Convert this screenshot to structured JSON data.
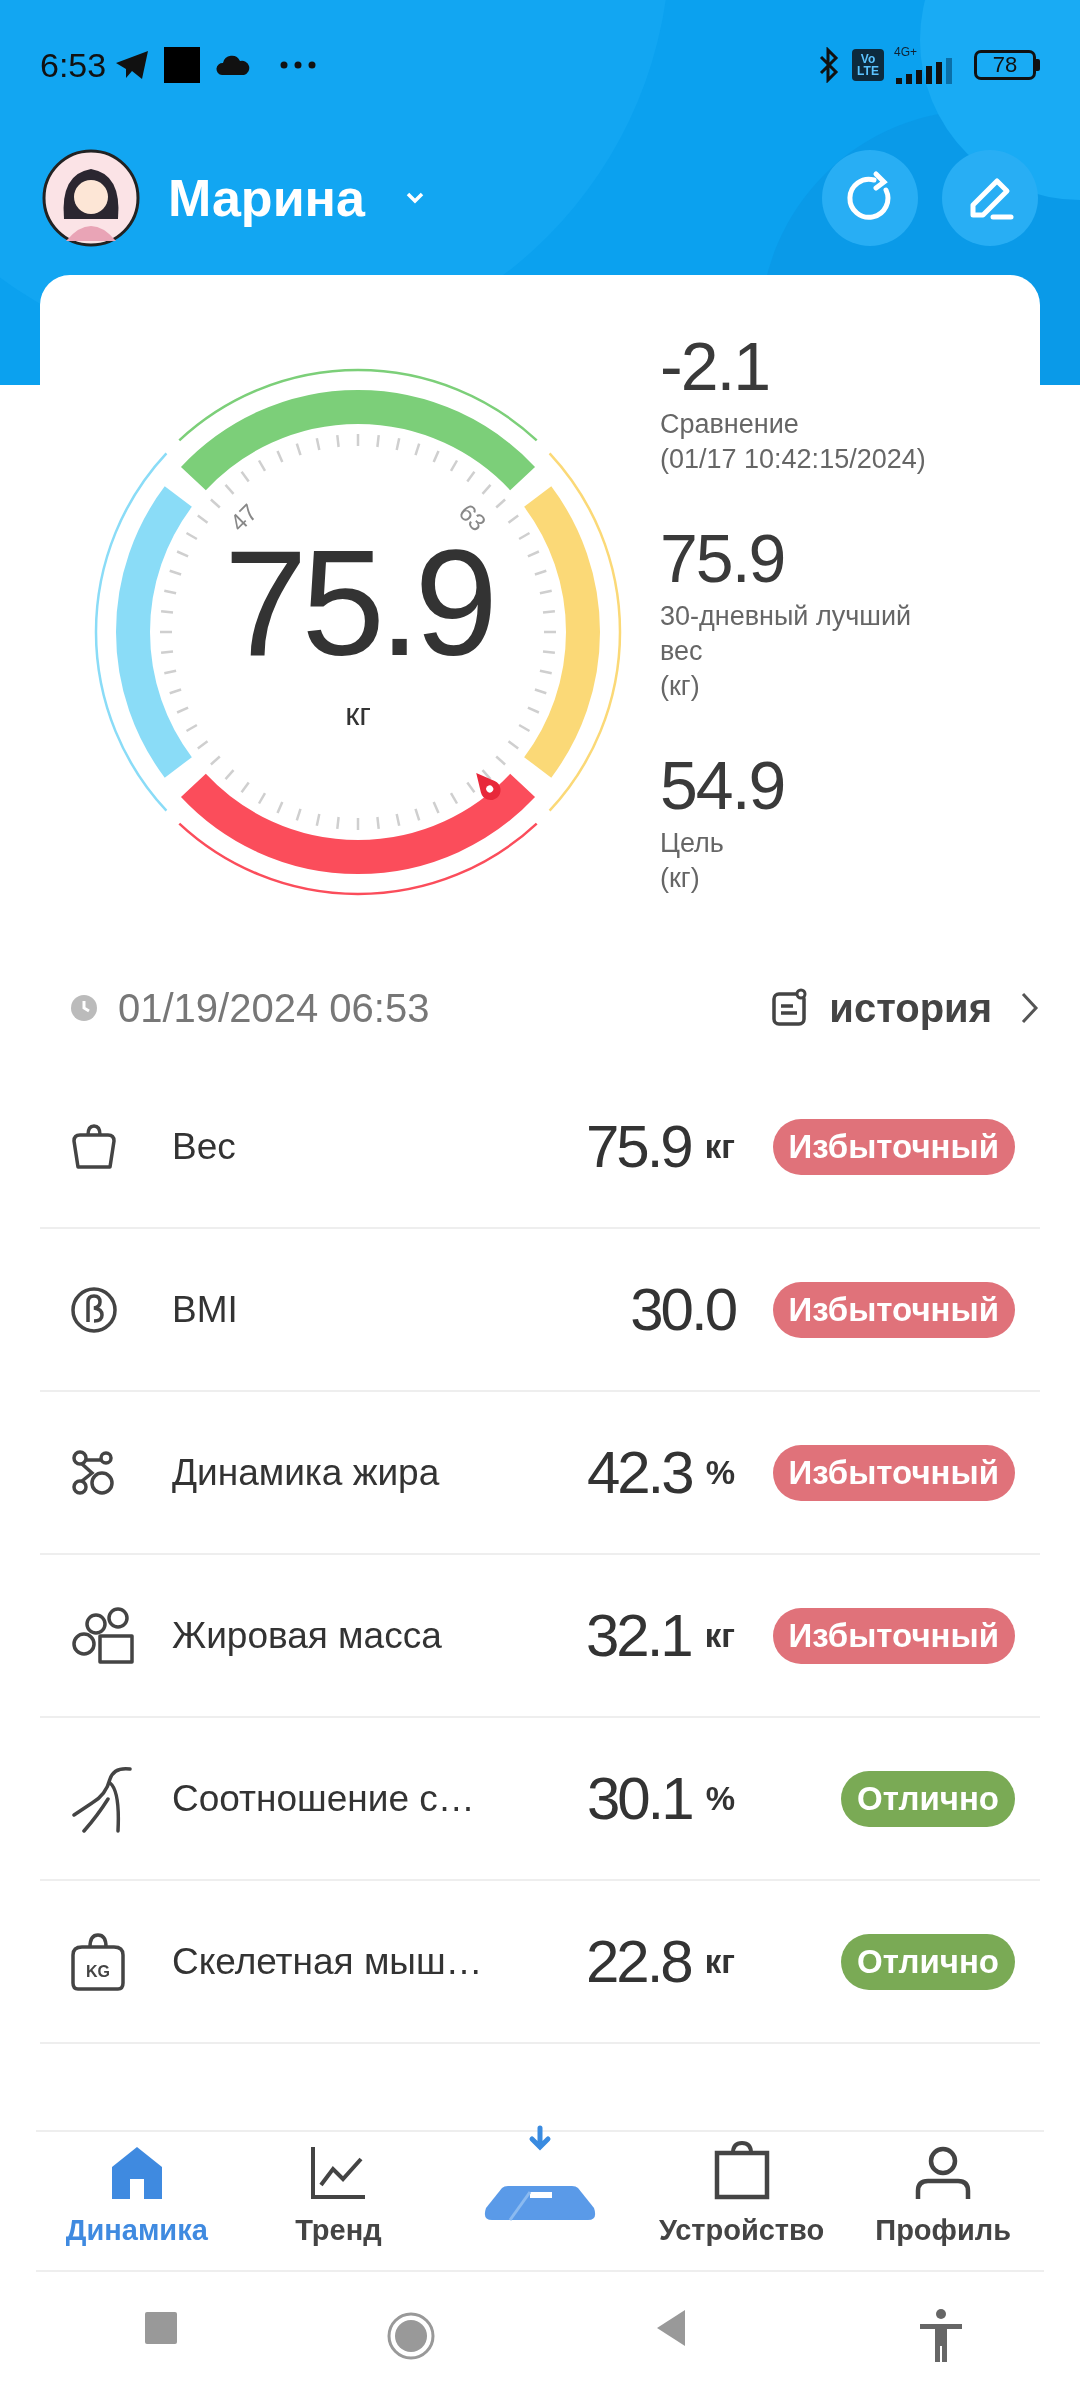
{
  "status_bar": {
    "time": "6:53",
    "volte": [
      "Vo",
      "LTE"
    ],
    "network": "4G+",
    "battery": "78"
  },
  "header": {
    "user_name": "Марина"
  },
  "gauge": {
    "value": "75.9",
    "unit": "кг",
    "tick_labels": [
      "47",
      "63"
    ]
  },
  "stats": [
    {
      "value": "-2.1",
      "lines": [
        "Сравнение",
        "(01/17 10:42:15/2024)"
      ]
    },
    {
      "value": "75.9",
      "lines": [
        "30-дневный лучший",
        "вес",
        "(кг)"
      ]
    },
    {
      "value": "54.9",
      "lines": [
        "Цель",
        "(кг)"
      ]
    }
  ],
  "measured_at": "01/19/2024 06:53",
  "history_link": "история",
  "metrics": [
    {
      "name": "Вес",
      "value": "75.9",
      "unit": "кг",
      "status": "Избыточный",
      "color": "#e0727a"
    },
    {
      "name": "BMI",
      "value": "30.0",
      "status": "Избыточный",
      "color": "#e0727a"
    },
    {
      "name": "Динамика жира",
      "value": "42.3",
      "unit": "%",
      "status": "Избыточный",
      "color": "#e0727a"
    },
    {
      "name": "Жировая масса",
      "value": "32.1",
      "unit": "кг",
      "status": "Избыточный",
      "color": "#e0727a"
    },
    {
      "name": "Соотношение с…",
      "value": "30.1",
      "unit": "%",
      "status": "Отлично",
      "color": "#7aaa55"
    },
    {
      "name": "Скелетная мыш…",
      "value": "22.8",
      "unit": "кг",
      "status": "Отлично",
      "color": "#7aaa55",
      "icon_label": "KG"
    }
  ],
  "nav": [
    {
      "kind": "tab",
      "label": "Динамика",
      "selected": true
    },
    {
      "kind": "tab",
      "label": "Тренд",
      "selected": false
    },
    {
      "kind": "scale"
    },
    {
      "kind": "tab",
      "label": "Устройство",
      "selected": false
    },
    {
      "kind": "tab",
      "label": "Профиль",
      "selected": false
    }
  ]
}
